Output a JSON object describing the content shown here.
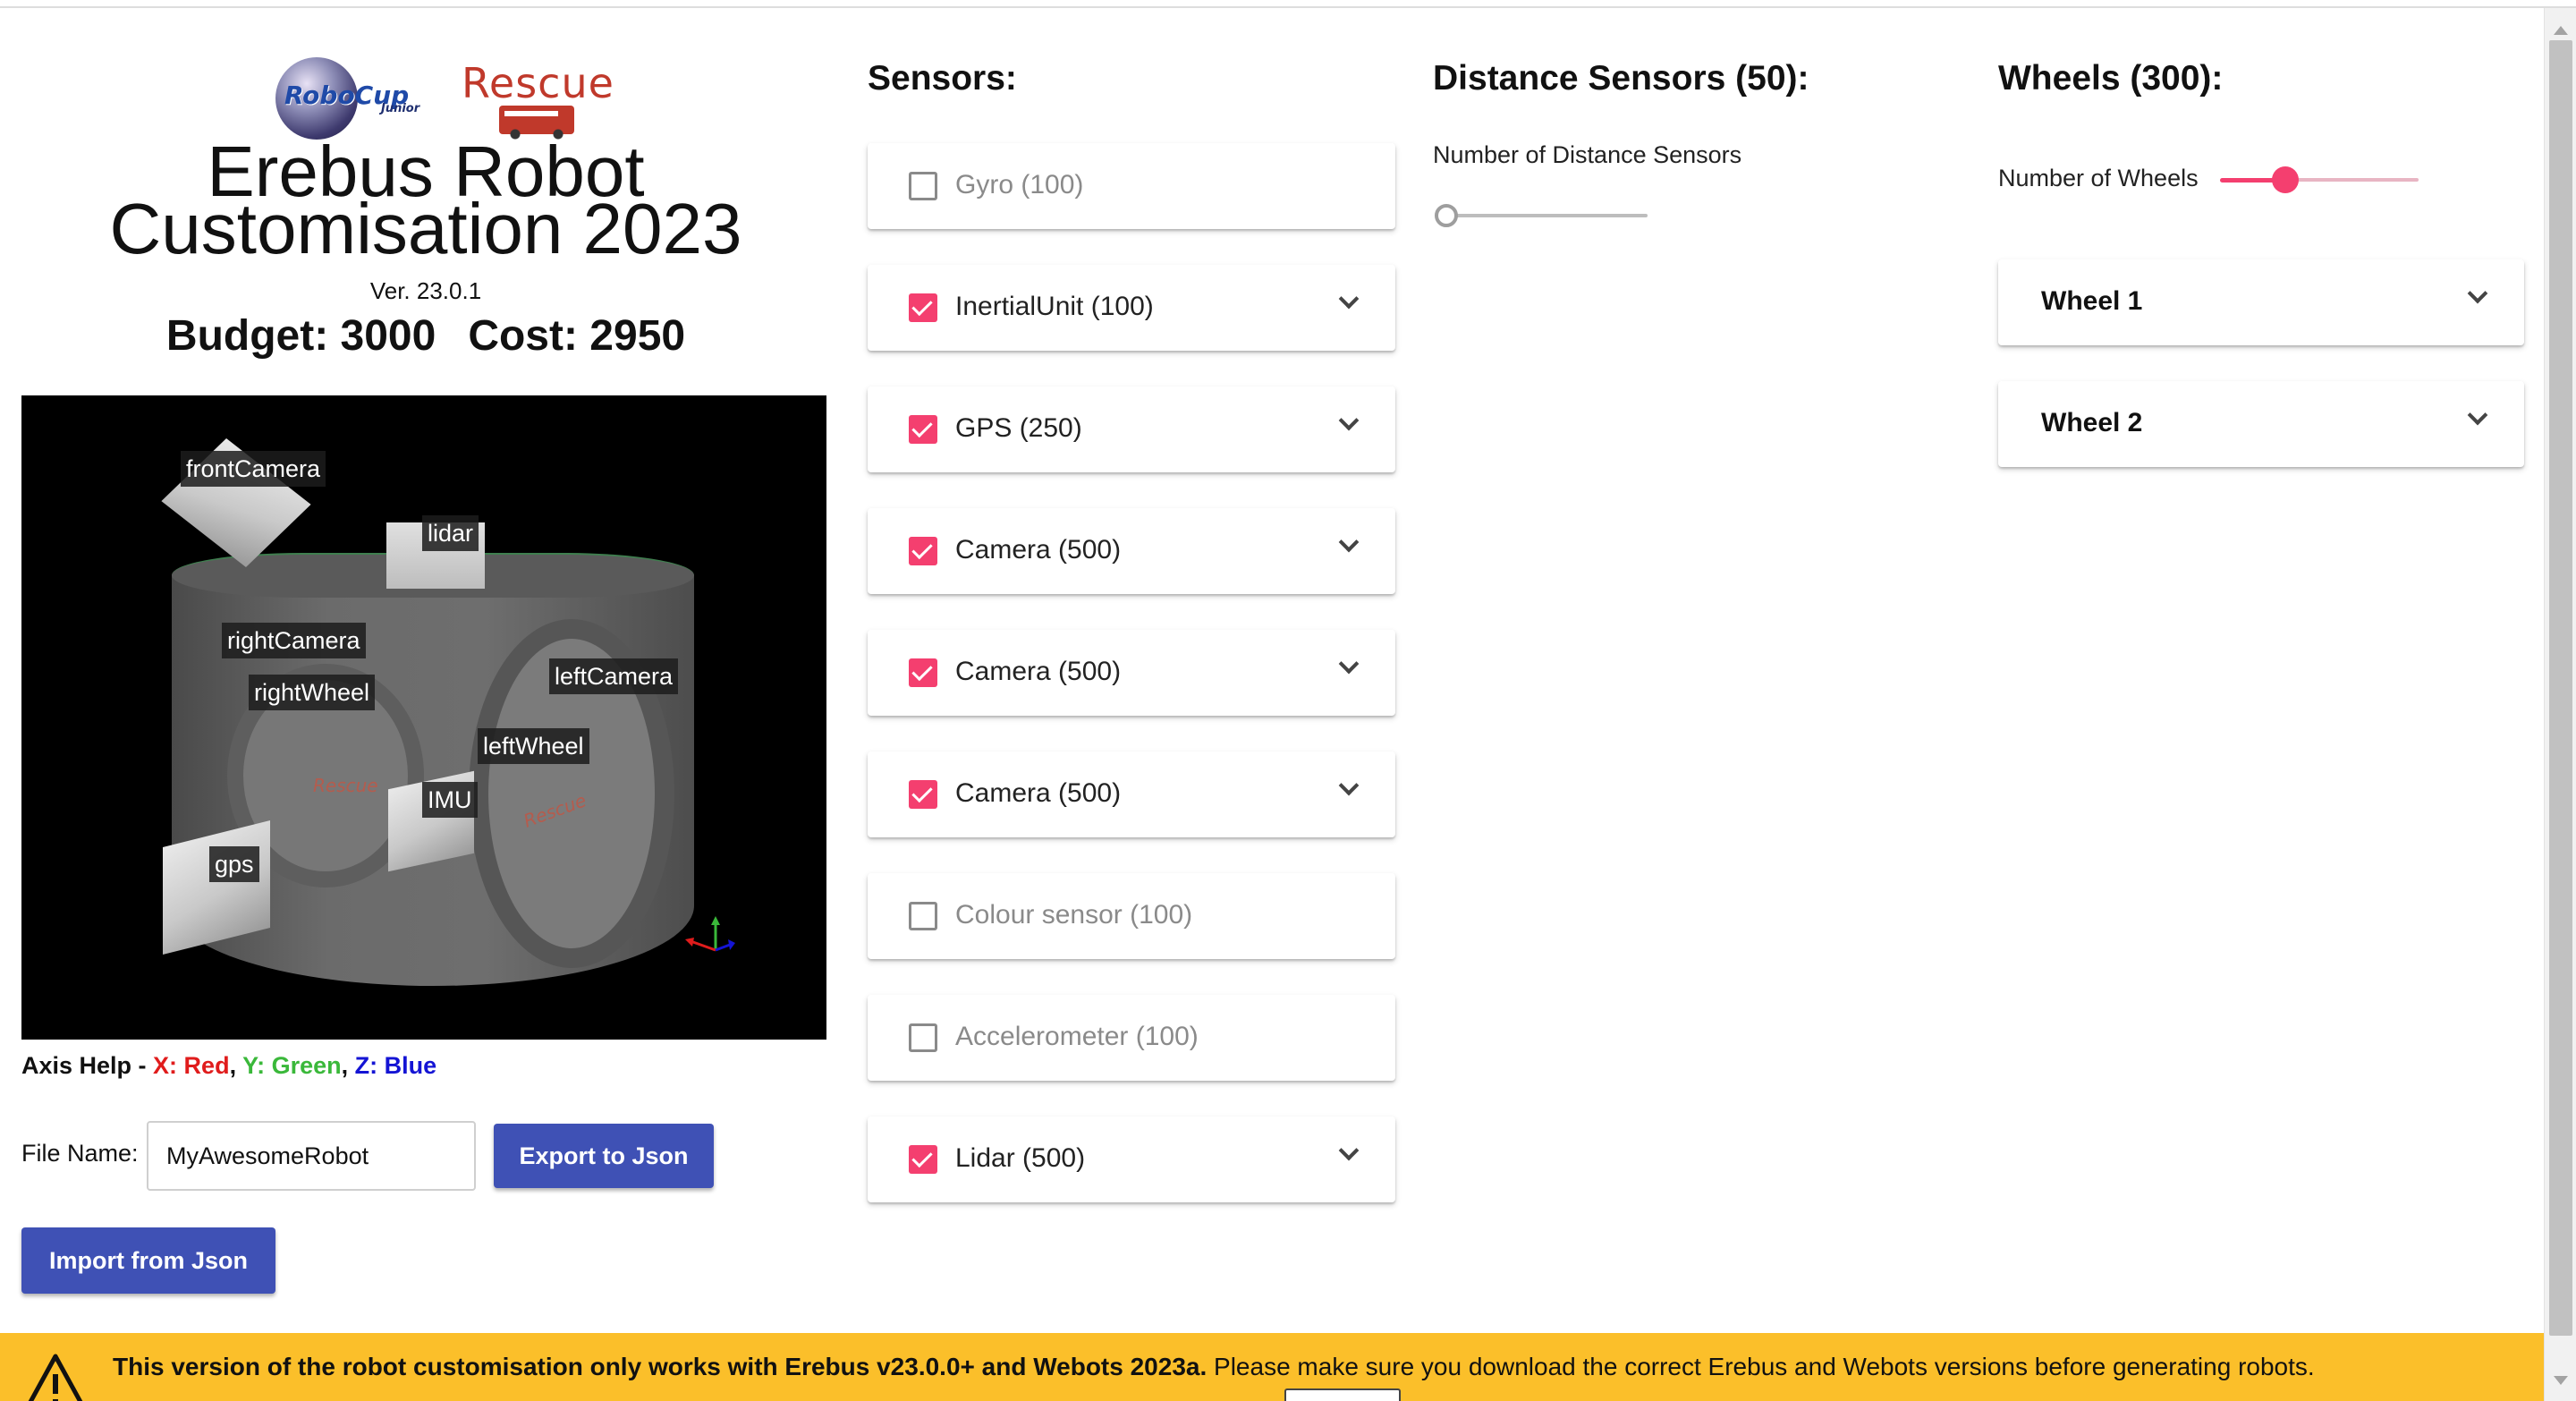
{
  "header": {
    "logo_robocup": "RoboCup",
    "logo_junior": "Junior",
    "logo_rescue": "Rescue",
    "title_line1": "Erebus Robot",
    "title_line2": "Customisation 2023",
    "version": "Ver. 23.0.1",
    "budget": "Budget: 3000",
    "cost": "Cost: 2950"
  },
  "viewer": {
    "labels": {
      "front_camera": "frontCamera",
      "lidar": "lidar",
      "right_camera": "rightCamera",
      "right_wheel": "rightWheel",
      "left_camera": "leftCamera",
      "left_wheel": "leftWheel",
      "imu": "IMU",
      "gps": "gps"
    },
    "wheel_logo": "Rescue"
  },
  "axis_help": {
    "prefix": "Axis Help - ",
    "x": "X: Red",
    "sep1": ", ",
    "y": "Y: Green",
    "sep2": ", ",
    "z": "Z: Blue",
    "colors": {
      "x": "#e01c1c",
      "y": "#3ab83a",
      "z": "#1414d4"
    }
  },
  "file": {
    "label": "File Name:",
    "value": "MyAwesomeRobot",
    "export_label": "Export to Json",
    "import_label": "Import from Json"
  },
  "sensors": {
    "title": "Sensors:",
    "items": [
      {
        "label": "Gyro (100)",
        "checked": false,
        "expandable": false
      },
      {
        "label": "InertialUnit (100)",
        "checked": true,
        "expandable": true
      },
      {
        "label": "GPS (250)",
        "checked": true,
        "expandable": true
      },
      {
        "label": "Camera (500)",
        "checked": true,
        "expandable": true
      },
      {
        "label": "Camera (500)",
        "checked": true,
        "expandable": true
      },
      {
        "label": "Camera (500)",
        "checked": true,
        "expandable": true
      },
      {
        "label": "Colour sensor (100)",
        "checked": false,
        "expandable": false
      },
      {
        "label": "Accelerometer (100)",
        "checked": false,
        "expandable": false
      },
      {
        "label": "Lidar (500)",
        "checked": true,
        "expandable": true
      }
    ]
  },
  "distance_sensors": {
    "title": "Distance Sensors (50):",
    "slider_label": "Number of Distance Sensors",
    "slider_fraction": 0
  },
  "wheels": {
    "title": "Wheels (300):",
    "slider_label": "Number of Wheels",
    "slider_fraction": 0.33,
    "items": [
      {
        "label": "Wheel 1"
      },
      {
        "label": "Wheel 2"
      }
    ]
  },
  "banner": {
    "bold_text": "This version of the robot customisation only works with Erebus v23.0.0+ and Webots 2023a.",
    "text": " Please make sure you download the correct Erebus and Webots versions before generating robots."
  },
  "theme": {
    "accent": "#f43f6f",
    "button": "#3f51b5",
    "banner_bg": "#fbbf2a"
  }
}
